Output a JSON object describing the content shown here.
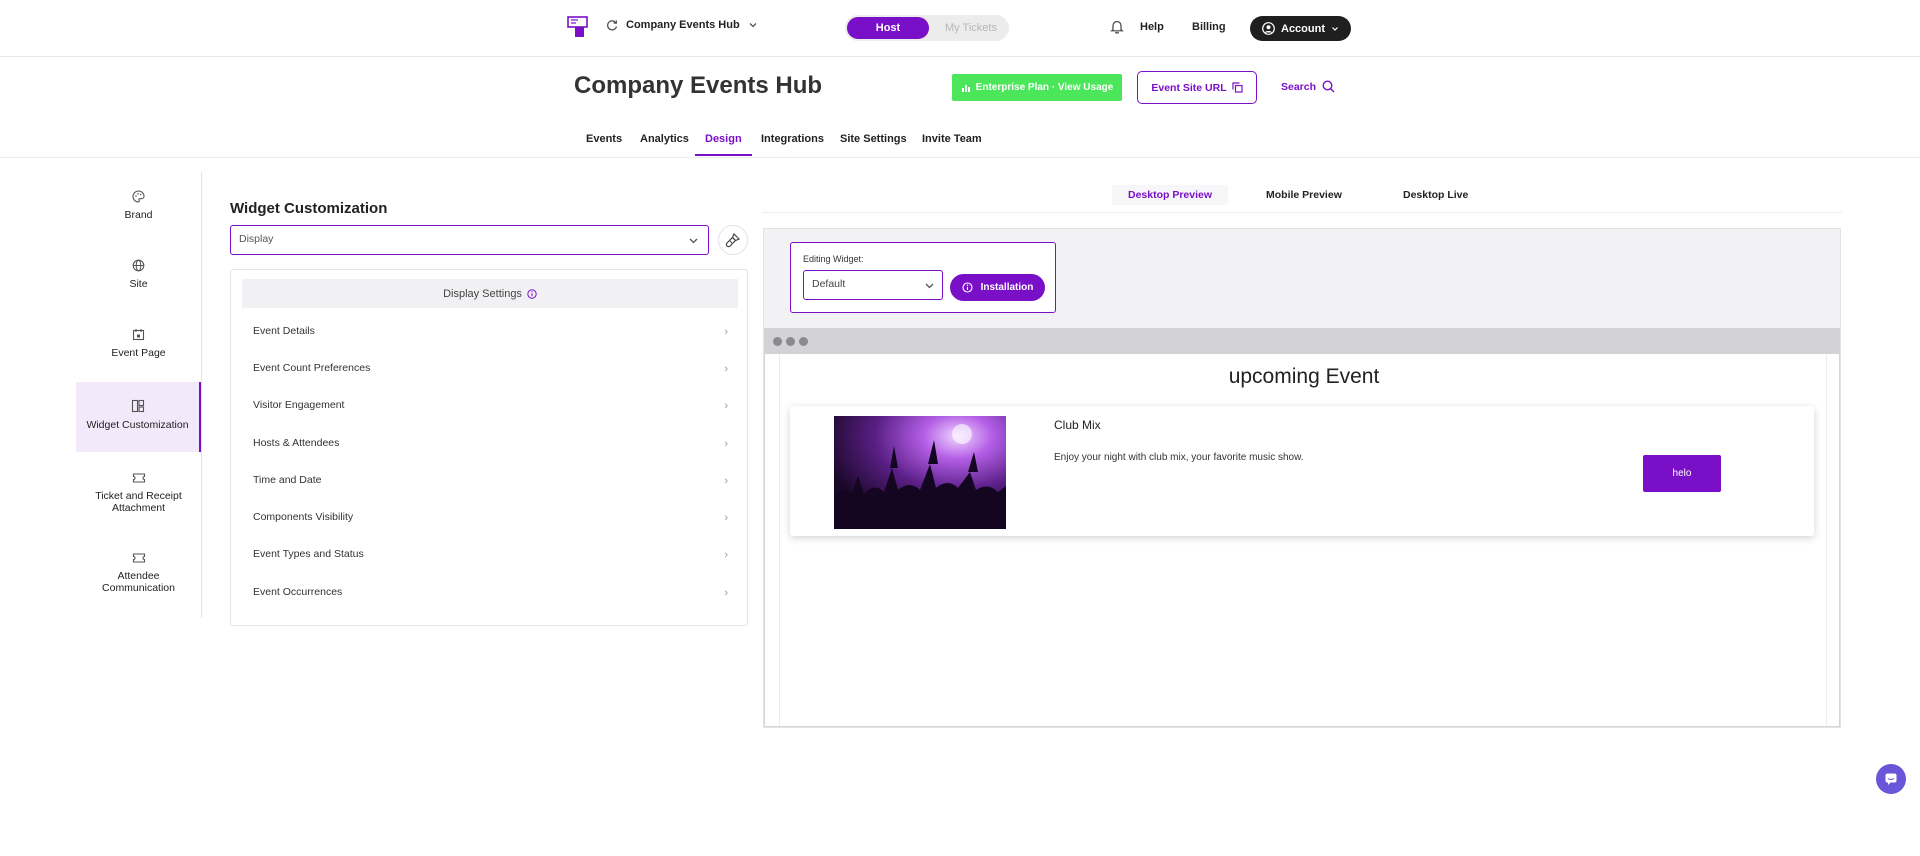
{
  "top_bar": {
    "hub_name": "Company Events Hub",
    "role_toggle": {
      "active": "Host",
      "inactive": "My Tickets"
    },
    "help": "Help",
    "billing": "Billing",
    "account": "Account"
  },
  "header": {
    "title": "Company Events Hub",
    "enterprise_button": "Enterprise Plan · View Usage",
    "site_url_button": "Event Site URL",
    "search": "Search"
  },
  "nav_tabs": [
    "Events",
    "Analytics",
    "Design",
    "Integrations",
    "Site Settings",
    "Invite Team"
  ],
  "active_nav_tab": "Design",
  "sidebar": {
    "items": [
      {
        "label": "Brand",
        "icon": "palette-icon"
      },
      {
        "label": "Site",
        "icon": "globe-icon"
      },
      {
        "label": "Event Page",
        "icon": "calendar-icon"
      },
      {
        "label": "Widget Customization",
        "icon": "layout-icon"
      },
      {
        "label": "Ticket and Receipt Attachment",
        "icon": "ticket-icon"
      },
      {
        "label": "Attendee Communication",
        "icon": "ticket-icon"
      }
    ],
    "active": "Widget Customization"
  },
  "widget_customization": {
    "title": "Widget Customization",
    "select_value": "Display",
    "settings_header": "Display Settings",
    "settings": [
      "Event Details",
      "Event Count Preferences",
      "Visitor Engagement",
      "Hosts & Attendees",
      "Time and Date",
      "Components Visibility",
      "Event Types and Status",
      "Event Occurrences"
    ]
  },
  "preview": {
    "tabs": [
      "Desktop Preview",
      "Mobile Preview",
      "Desktop Live"
    ],
    "active_tab": "Desktop Preview",
    "editing_label": "Editing Widget:",
    "widget_select": "Default",
    "installation_button": "Installation",
    "heading": "upcoming Event",
    "event": {
      "name": "Club Mix",
      "description": "Enjoy your night with club mix, your favorite music show.",
      "button": "helo"
    }
  },
  "colors": {
    "accent": "#7a0fc8",
    "enterprise_green": "#4ce65a",
    "account_dark": "#1f1f1f"
  }
}
